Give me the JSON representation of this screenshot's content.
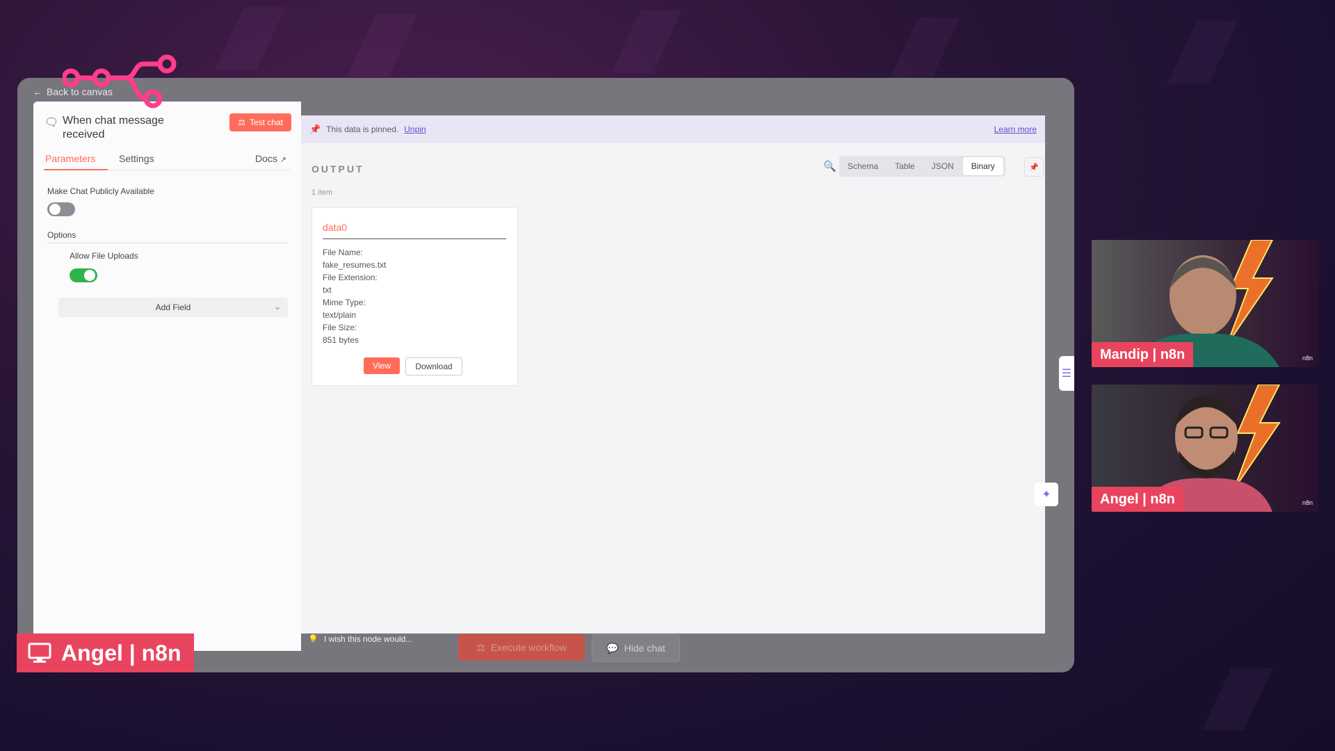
{
  "back_link": "Back to canvas",
  "node": {
    "title": "When chat message received",
    "test_button": "Test chat",
    "tabs": [
      "Parameters",
      "Settings",
      "Docs"
    ],
    "make_public_label": "Make Chat Publicly Available",
    "make_public_enabled": false,
    "options_label": "Options",
    "allow_uploads_label": "Allow File Uploads",
    "allow_uploads_enabled": true,
    "add_field": "Add Field",
    "wish_text": "I wish this node would..."
  },
  "output": {
    "pinned_text": "This data is pinned.",
    "unpin": "Unpin",
    "learn_more": "Learn more",
    "title": "OUTPUT",
    "item_count": "1 item",
    "view_tabs": [
      "Schema",
      "Table",
      "JSON",
      "Binary"
    ],
    "active_view": "Binary",
    "card": {
      "title": "data0",
      "fields": [
        "File Name:",
        "fake_resumes.txt",
        "File Extension:",
        "txt",
        "Mime Type:",
        "text/plain",
        "File Size:",
        "851 bytes"
      ],
      "view": "View",
      "download": "Download"
    }
  },
  "footer": {
    "execute": "Execute workflow",
    "hide_chat": "Hide chat"
  },
  "presenter": "Angel | n8n",
  "cams": [
    {
      "name": "Mandip | n8n",
      "tag": "n8n"
    },
    {
      "name": "Angel | n8n",
      "tag": "n8n"
    }
  ],
  "colors": {
    "accent": "#ff6d5a",
    "pinned_accent": "#5b4ed0",
    "toggle_on": "#2fb34b",
    "stream_pink": "#e9445e"
  }
}
